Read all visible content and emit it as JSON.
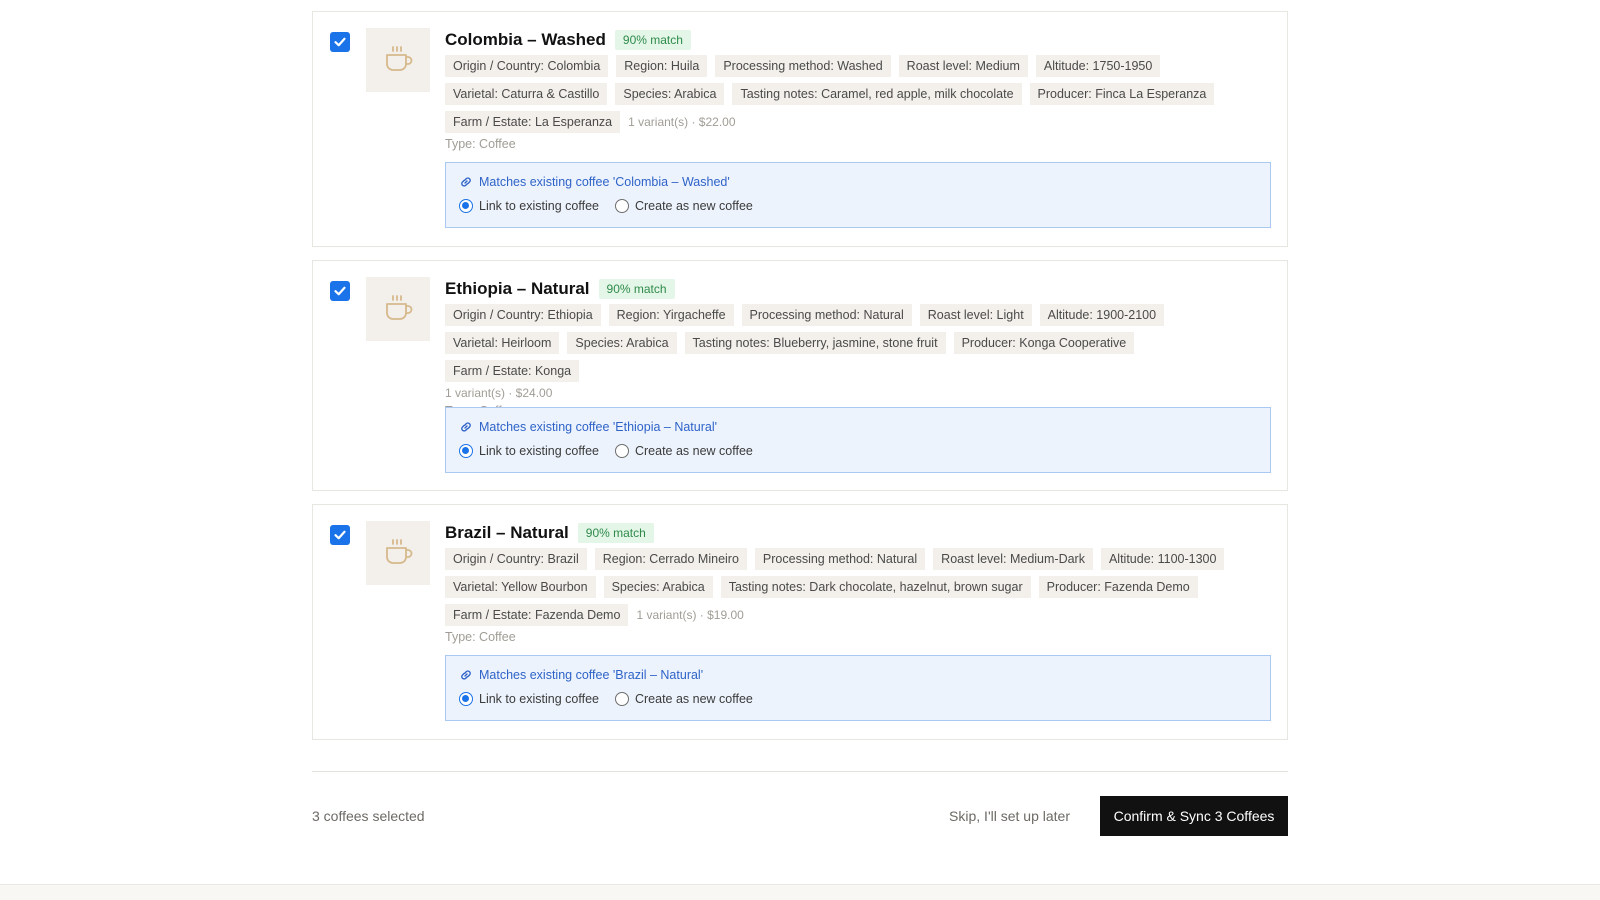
{
  "colors": {
    "accent": "#1a73e8",
    "match_badge_bg": "#e3f6e8",
    "match_badge_text": "#2f8a4a",
    "tag_bg": "#f3f0eb",
    "match_box_bg": "#ecf3fd",
    "confirm_bg": "#111111"
  },
  "coffees": [
    {
      "checked": true,
      "thumbnail_icon": "coffee-cup-icon",
      "title": "Colombia – Washed",
      "match": "90% match",
      "tags": [
        "Origin / Country: Colombia",
        "Region: Huila",
        "Processing method: Washed",
        "Roast level: Medium",
        "Altitude: 1750-1950",
        "Varietal: Caturra & Castillo",
        "Species: Arabica",
        "Tasting notes: Caramel, red apple, milk chocolate",
        "Producer: Finca La Esperanza",
        "Farm / Estate: La Esperanza"
      ],
      "variants": "1 variant(s) · $22.00",
      "type": "Type: Coffee",
      "match_text": "Matches existing coffee 'Colombia – Washed'",
      "options": [
        "Link to existing coffee",
        "Create as new coffee"
      ],
      "selected_option": "Link to existing coffee"
    },
    {
      "checked": true,
      "thumbnail_icon": "coffee-cup-icon",
      "title": "Ethiopia – Natural",
      "match": "90% match",
      "tags": [
        "Origin / Country: Ethiopia",
        "Region: Yirgacheffe",
        "Processing method: Natural",
        "Roast level: Light",
        "Altitude: 1900-2100",
        "Varietal: Heirloom",
        "Species: Arabica",
        "Tasting notes: Blueberry, jasmine, stone fruit",
        "Producer: Konga Cooperative",
        "Farm / Estate: Konga"
      ],
      "variants": "1 variant(s) · $24.00",
      "type": "Type: Coffee",
      "match_text": "Matches existing coffee 'Ethiopia – Natural'",
      "options": [
        "Link to existing coffee",
        "Create as new coffee"
      ],
      "selected_option": "Link to existing coffee"
    },
    {
      "checked": true,
      "thumbnail_icon": "coffee-cup-icon",
      "title": "Brazil – Natural",
      "match": "90% match",
      "tags": [
        "Origin / Country: Brazil",
        "Region: Cerrado Mineiro",
        "Processing method: Natural",
        "Roast level: Medium-Dark",
        "Altitude: 1100-1300",
        "Varietal: Yellow Bourbon",
        "Species: Arabica",
        "Tasting notes: Dark chocolate, hazelnut, brown sugar",
        "Producer: Fazenda Demo",
        "Farm / Estate: Fazenda Demo"
      ],
      "variants": "1 variant(s) · $19.00",
      "type": "Type: Coffee",
      "match_text": "Matches existing coffee 'Brazil – Natural'",
      "options": [
        "Link to existing coffee",
        "Create as new coffee"
      ],
      "selected_option": "Link to existing coffee"
    }
  ],
  "footer": {
    "selected_count": "3 coffees selected",
    "skip_label": "Skip, I'll set up later",
    "confirm_label": "Confirm & Sync 3 Coffees"
  }
}
